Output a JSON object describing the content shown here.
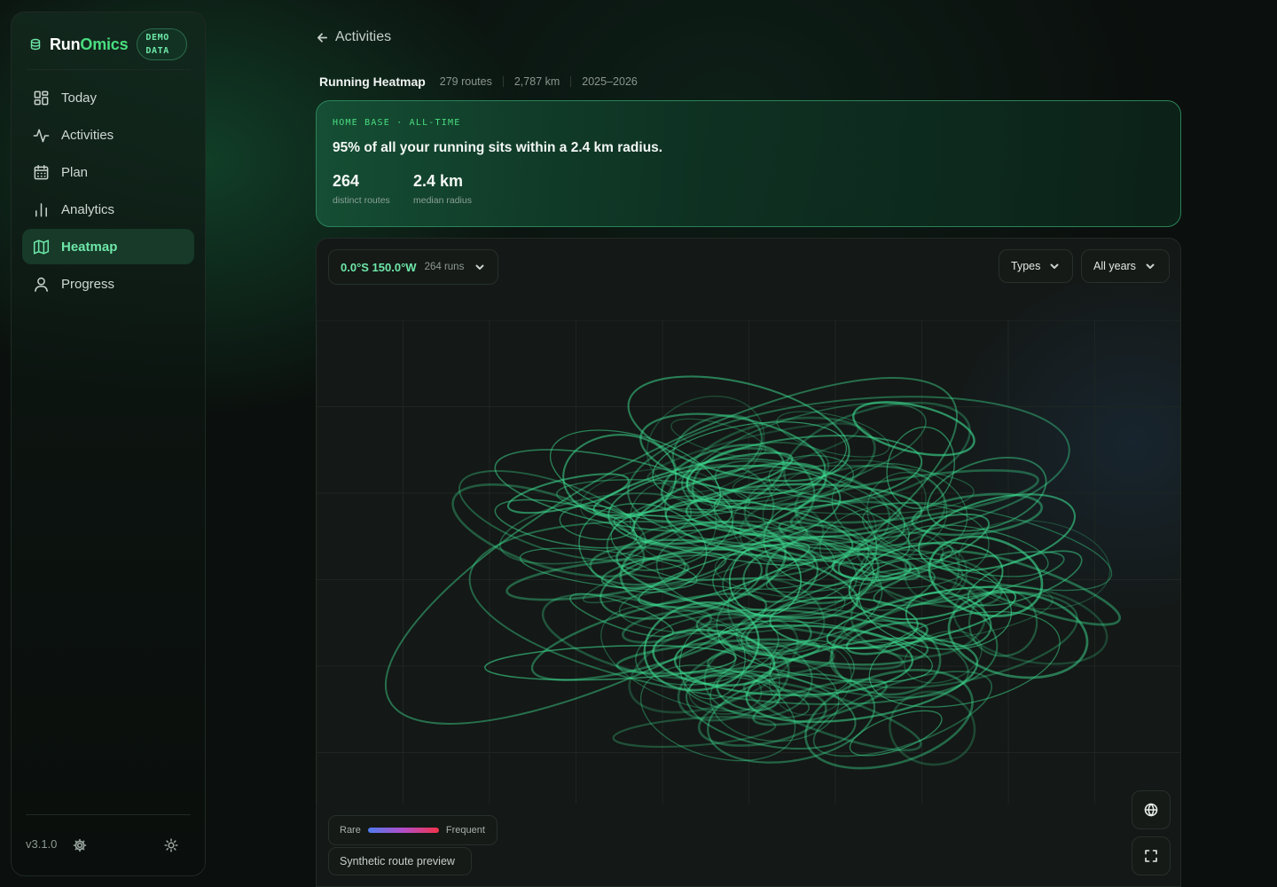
{
  "brand": {
    "name_part1": "Run",
    "name_part2": "Omics",
    "badge": "DEMO DATA",
    "icon": "stack-icon"
  },
  "nav": [
    {
      "label": "Today",
      "icon": "grid-icon",
      "active": false
    },
    {
      "label": "Activities",
      "icon": "activity-icon",
      "active": false
    },
    {
      "label": "Plan",
      "icon": "calendar-icon",
      "active": false
    },
    {
      "label": "Analytics",
      "icon": "bar-chart-icon",
      "active": false
    },
    {
      "label": "Heatmap",
      "icon": "map-icon",
      "active": true
    },
    {
      "label": "Progress",
      "icon": "user-icon",
      "active": false
    }
  ],
  "footer": {
    "version": "v3.1.0"
  },
  "page": {
    "back_label": "Activities",
    "title": "Running Heatmap",
    "routes": "279 routes",
    "distance": "2,787 km",
    "years": "2025–2026"
  },
  "home_base": {
    "kicker": "HOME BASE · ALL-TIME",
    "headline": "95% of all your running sits within a 2.4 km radius.",
    "stats": [
      {
        "value": "264",
        "label": "distinct routes"
      },
      {
        "value": "2.4 km",
        "label": "median radius"
      }
    ]
  },
  "map": {
    "location": "0.0°S 150.0°W",
    "location_runs": "264 runs",
    "filters": {
      "types": "Types",
      "years": "All years"
    },
    "legend": {
      "rare": "Rare",
      "frequent": "Frequent"
    },
    "preview_label": "Synthetic route preview",
    "route_color": "#3ddc91"
  },
  "colors": {
    "accent": "#4ade80",
    "active_bg": "#173a29",
    "card_border": "#2a8358"
  }
}
